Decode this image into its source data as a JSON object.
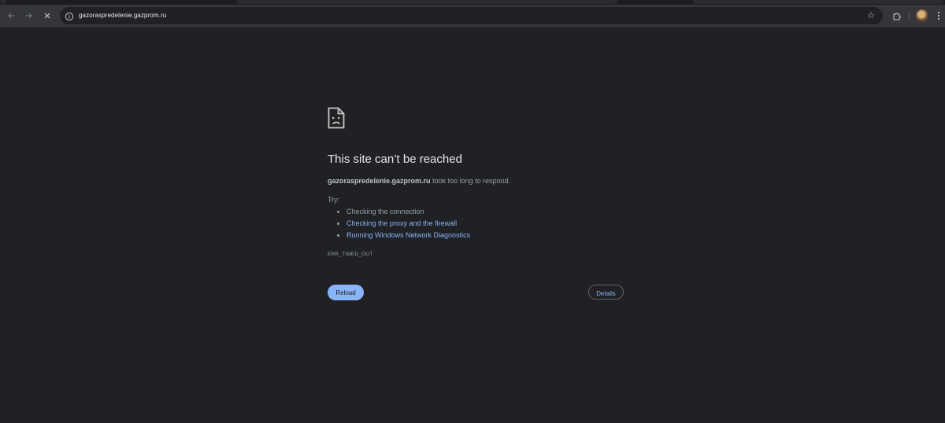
{
  "browser": {
    "url": "gazoraspredelenie.gazprom.ru",
    "icons": {
      "back": "back-arrow-icon",
      "forward": "forward-arrow-icon",
      "stop": "stop-loading-icon",
      "site_info": "site-info-icon",
      "bookmark": "bookmark-star-icon",
      "extensions": "extensions-puzzle-icon",
      "profile": "profile-avatar",
      "menu": "kebab-menu-icon"
    }
  },
  "error_page": {
    "title": "This site can’t be reached",
    "host": "gazoraspredelenie.gazprom.ru",
    "message": "took too long to respond.",
    "try_label": "Try:",
    "suggestions": [
      "Checking the connection",
      "Checking the proxy and the firewall",
      "Running Windows Network Diagnostics"
    ],
    "error_code": "ERR_TIMED_OUT",
    "reload_label": "Reload",
    "details_label": "Details"
  },
  "colors": {
    "background": "#202124",
    "toolbar": "#35363a",
    "primary_text": "#e8eaed",
    "secondary_text": "#9aa0a6",
    "link": "#8ab4f8"
  }
}
